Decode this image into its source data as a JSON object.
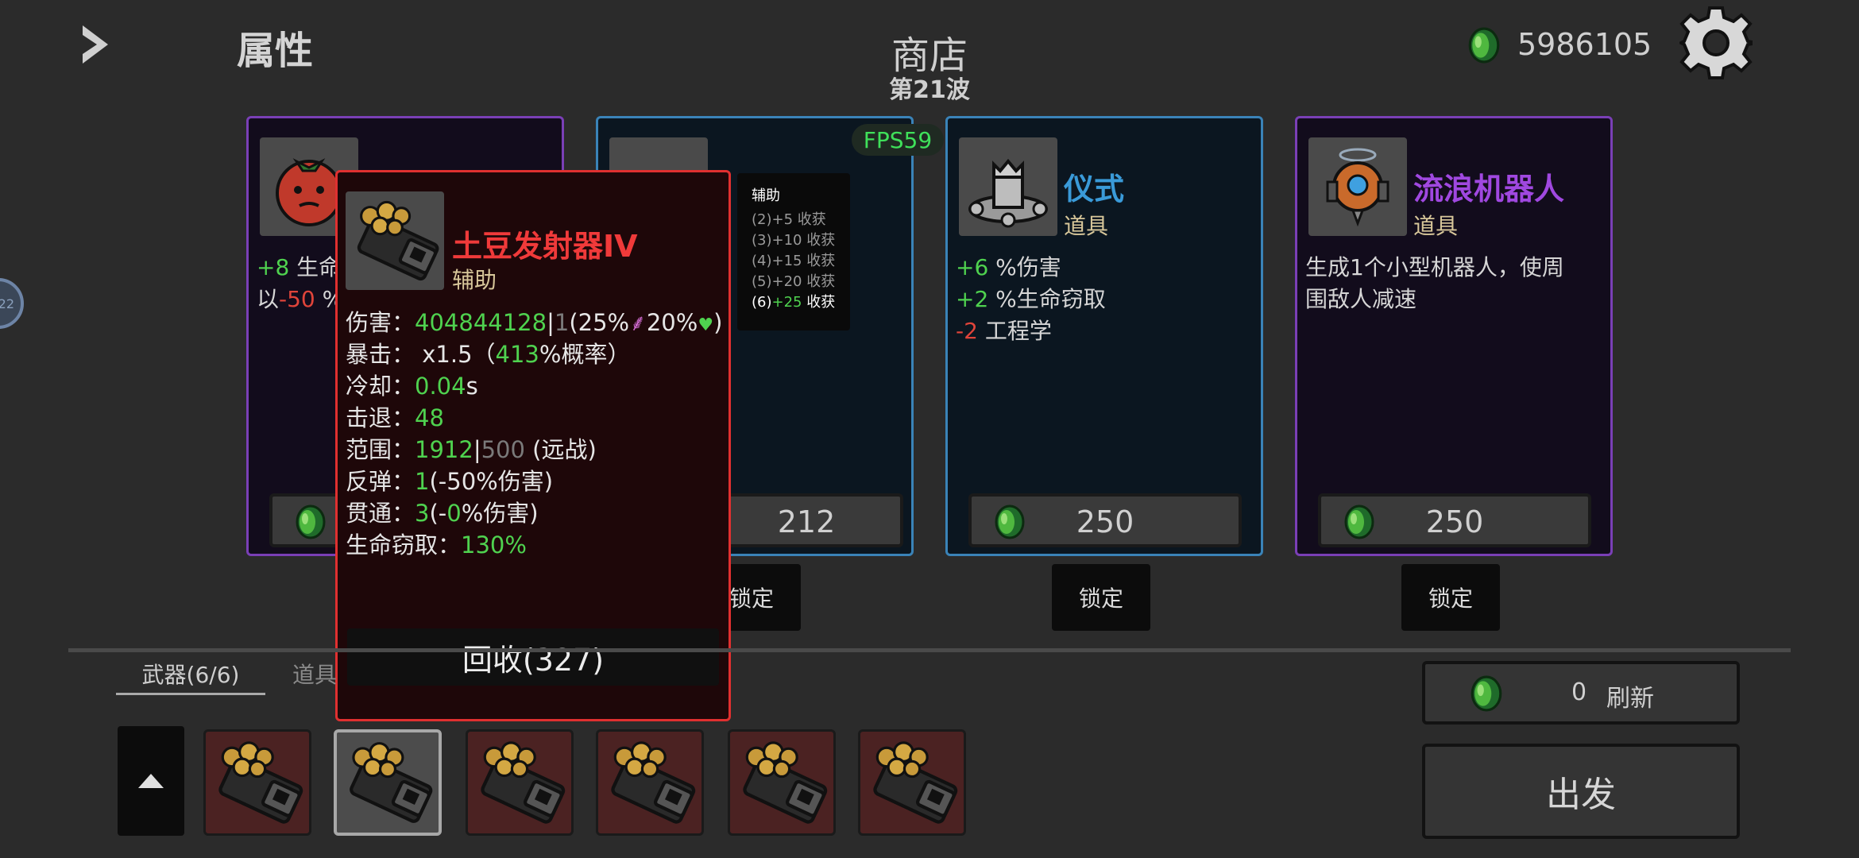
{
  "header": {
    "attributes_title": "属性",
    "shop_title": "商店",
    "wave": "第21波",
    "coins": "5986105",
    "side_badge": "22",
    "fps": "FPS59"
  },
  "colors": {
    "legendary": "#7a3fb6",
    "rare": "#3a83b8",
    "popup_border": "#e03030",
    "positive": "#4fd24f",
    "negative": "#e0443a",
    "item_name_blue": "#3a9ad8",
    "item_name_purple": "#a048e0"
  },
  "cards": [
    {
      "icon": "tomato-icon",
      "stat1_value": "+8",
      "stat1_text": " 生命",
      "stat1_suffix": "",
      "stat2_prefix": "以",
      "stat2_value": "-50",
      "stat2_suffix": " %"
    },
    {
      "icon": "pepper-icon",
      "name_partial": "",
      "price": "212",
      "lock_label": "锁定"
    },
    {
      "icon": "ritual-icon",
      "name": "仪式",
      "type": "道具",
      "stats": [
        {
          "value": "+6",
          "text": " %伤害"
        },
        {
          "value": "+2",
          "text": " %生命窃取"
        },
        {
          "value": "-2",
          "text": " 工程学"
        }
      ],
      "price": "250",
      "lock_label": "锁定"
    },
    {
      "icon": "robot-icon",
      "name": "流浪机器人",
      "type": "道具",
      "description_line1": "生成1个小型机器人，使周",
      "description_line2": "围敌人减速",
      "price": "250",
      "lock_label": "锁定"
    }
  ],
  "assist_tooltip": {
    "title": "辅助",
    "lines": [
      "(2)+5 收获",
      "(3)+10 收获",
      "(4)+15 收获",
      "(5)+20 收获"
    ],
    "active_prefix": "(6)",
    "active_value": "+25",
    "active_suffix": " 收获"
  },
  "popup": {
    "icon": "potato-launcher-icon",
    "name": "土豆发射器IV",
    "type": "辅助",
    "damage_label": "伤害：",
    "damage_value": "404844128",
    "damage_sep": "|",
    "damage_base": "1",
    "damage_scaling_1": "(25%",
    "damage_scaling_2": "20%",
    "damage_close": ")",
    "crit_label": "暴击：",
    "crit_mult": " x1.5（",
    "crit_value": "413",
    "crit_suffix": "%概率）",
    "cooldown_label": "冷却：",
    "cooldown_value": "0.04",
    "cooldown_unit": "s",
    "knockback_label": "击退：",
    "knockback_value": "48",
    "range_label": "范围：",
    "range_value": "1912",
    "range_sep": "|",
    "range_base": "500",
    "range_suffix": " (远战)",
    "bounce_label": "反弹：",
    "bounce_value": "1",
    "bounce_suffix": "(-50%伤害)",
    "pierce_label": "贯通：",
    "pierce_value": "3",
    "pierce_mid": "(-",
    "pierce_pct": "0",
    "pierce_suffix": "%伤害)",
    "lifesteal_label": "生命窃取：",
    "lifesteal_value": "130%",
    "recycle_label": "回收(327)"
  },
  "bottom": {
    "tab_weapons": "武器(6/6)",
    "tab_items": "道具",
    "weapon_slots": [
      "potato-launcher-icon",
      "potato-launcher-icon",
      "potato-launcher-icon",
      "potato-launcher-icon",
      "potato-launcher-icon",
      "potato-launcher-icon"
    ],
    "selected_slot": 2,
    "refresh_cost": "0",
    "refresh_label": "刷新",
    "go_label": "出发"
  }
}
